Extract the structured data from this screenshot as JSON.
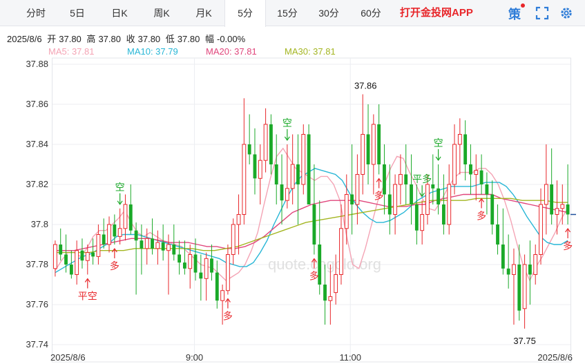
{
  "tabs": [
    "分时",
    "5日",
    "日K",
    "周K",
    "月K",
    "5分",
    "15分",
    "30分",
    "60分"
  ],
  "active_tab": "5分",
  "promo_text": "打开金投网APP",
  "strategy_label": "策",
  "toolbar_icons": [
    "fullscreen-icon",
    "settings-gear-icon"
  ],
  "info_bar": {
    "date": "2025/8/6",
    "open_label": "开",
    "open": "37.80",
    "high_label": "高",
    "high": "37.80",
    "close_label": "收",
    "close": "37.80",
    "low_label": "低",
    "low": "37.80",
    "change_label": "幅",
    "change": "-0.00%"
  },
  "ma_legend": [
    {
      "text": "MA5: 37.81",
      "color": "#f4a3b4"
    },
    {
      "text": "MA10: 37.79",
      "color": "#27b6d6"
    },
    {
      "text": "MA20: 37.81",
      "color": "#e0457b"
    },
    {
      "text": "MA30: 37.81",
      "color": "#a3b520"
    }
  ],
  "watermark": "quote.cngold.org",
  "colors": {
    "up": "#e8262a",
    "down": "#1aa928",
    "grid": "#eceef2"
  },
  "chart_data": {
    "type": "candlestick",
    "y_ticks": [
      "37.88",
      "37.86",
      "37.84",
      "37.82",
      "37.8",
      "37.78",
      "37.76",
      "37.74"
    ],
    "ylim": [
      37.74,
      37.88
    ],
    "x_tick_labels": [
      "2025/8/6",
      "9:00",
      "11:00",
      "2025/8/6"
    ],
    "high_label": "37.86",
    "low_label": "37.75",
    "series": [
      {
        "name": "MA5",
        "values": [
          37.777,
          37.782,
          37.786,
          37.786,
          37.784,
          37.788,
          37.794,
          37.797,
          37.797,
          37.8,
          37.803,
          37.807,
          37.801,
          37.796,
          37.794,
          37.796,
          37.794,
          37.792,
          37.791,
          37.79,
          37.789,
          37.786,
          37.783,
          37.78,
          37.779,
          37.778,
          37.775,
          37.772,
          37.774,
          37.776,
          37.78,
          37.787,
          37.796,
          37.81,
          37.823,
          37.834,
          37.838,
          37.833,
          37.828,
          37.826,
          37.824,
          37.822,
          37.824,
          37.824,
          37.82,
          37.812,
          37.795,
          37.78,
          37.778,
          37.788,
          37.8,
          37.812,
          37.82,
          37.828,
          37.834,
          37.833,
          37.826,
          37.82,
          37.813,
          37.808,
          37.807,
          37.812,
          37.818,
          37.823,
          37.826,
          37.826,
          37.826,
          37.828,
          37.828,
          37.825,
          37.82,
          37.812,
          37.802,
          37.79,
          37.779,
          37.772,
          37.779,
          37.784,
          37.79,
          37.796,
          37.803,
          37.808
        ]
      },
      {
        "name": "MA10",
        "values": [
          37.776,
          37.778,
          37.78,
          37.782,
          37.784,
          37.785,
          37.787,
          37.789,
          37.791,
          37.794,
          37.795,
          37.795,
          37.795,
          37.794,
          37.793,
          37.792,
          37.791,
          37.79,
          37.789,
          37.788,
          37.787,
          37.786,
          37.785,
          37.784,
          37.783,
          37.781,
          37.78,
          37.779,
          37.779,
          37.781,
          37.786,
          37.792,
          37.8,
          37.807,
          37.814,
          37.82,
          37.824,
          37.826,
          37.828,
          37.827,
          37.826,
          37.825,
          37.822,
          37.816,
          37.81,
          37.806,
          37.803,
          37.801,
          37.801,
          37.802,
          37.804,
          37.806,
          37.809,
          37.812,
          37.814,
          37.816,
          37.817,
          37.818,
          37.819,
          37.819,
          37.819,
          37.819,
          37.82,
          37.821,
          37.821,
          37.821,
          37.819,
          37.815,
          37.81,
          37.804,
          37.799,
          37.794,
          37.791,
          37.79,
          37.79,
          37.792
        ]
      },
      {
        "name": "MA20",
        "values": [
          37.787,
          37.787,
          37.787,
          37.788,
          37.789,
          37.79,
          37.791,
          37.792,
          37.793,
          37.793,
          37.793,
          37.792,
          37.791,
          37.791,
          37.791,
          37.79,
          37.789,
          37.789,
          37.788,
          37.788,
          37.789,
          37.791,
          37.794,
          37.798,
          37.802,
          37.806,
          37.808,
          37.81,
          37.811,
          37.812,
          37.812,
          37.812,
          37.812,
          37.811,
          37.81,
          37.809,
          37.809,
          37.809,
          37.81,
          37.81,
          37.812,
          37.813,
          37.814,
          37.815,
          37.815,
          37.815,
          37.815,
          37.813,
          37.812,
          37.811,
          37.81,
          37.809,
          37.808,
          37.807,
          37.806
        ]
      },
      {
        "name": "MA30",
        "values": [
          37.786,
          37.786,
          37.786,
          37.786,
          37.787,
          37.787,
          37.787,
          37.788,
          37.788,
          37.788,
          37.788,
          37.788,
          37.788,
          37.787,
          37.787,
          37.788,
          37.789,
          37.791,
          37.793,
          37.795,
          37.797,
          37.799,
          37.801,
          37.802,
          37.803,
          37.804,
          37.805,
          37.806,
          37.807,
          37.808,
          37.809,
          37.81,
          37.811,
          37.812,
          37.812,
          37.812,
          37.812,
          37.813,
          37.813,
          37.813,
          37.813,
          37.812,
          37.812,
          37.812,
          37.811,
          37.811
        ]
      }
    ],
    "candles": [
      {
        "o": 37.778,
        "h": 37.792,
        "l": 37.774,
        "c": 37.79
      },
      {
        "o": 37.79,
        "h": 37.798,
        "l": 37.782,
        "c": 37.785
      },
      {
        "o": 37.785,
        "h": 37.795,
        "l": 37.776,
        "c": 37.78
      },
      {
        "o": 37.78,
        "h": 37.787,
        "l": 37.773,
        "c": 37.775
      },
      {
        "o": 37.775,
        "h": 37.792,
        "l": 37.77,
        "c": 37.787
      },
      {
        "o": 37.787,
        "h": 37.793,
        "l": 37.778,
        "c": 37.782
      },
      {
        "o": 37.782,
        "h": 37.79,
        "l": 37.775,
        "c": 37.786
      },
      {
        "o": 37.786,
        "h": 37.793,
        "l": 37.78,
        "c": 37.784
      },
      {
        "o": 37.784,
        "h": 37.8,
        "l": 37.78,
        "c": 37.795
      },
      {
        "o": 37.795,
        "h": 37.803,
        "l": 37.788,
        "c": 37.79
      },
      {
        "o": 37.79,
        "h": 37.804,
        "l": 37.786,
        "c": 37.8
      },
      {
        "o": 37.8,
        "h": 37.805,
        "l": 37.79,
        "c": 37.794
      },
      {
        "o": 37.794,
        "h": 37.808,
        "l": 37.79,
        "c": 37.798
      },
      {
        "o": 37.798,
        "h": 37.815,
        "l": 37.792,
        "c": 37.81
      },
      {
        "o": 37.81,
        "h": 37.82,
        "l": 37.795,
        "c": 37.797
      },
      {
        "o": 37.797,
        "h": 37.801,
        "l": 37.765,
        "c": 37.792
      },
      {
        "o": 37.792,
        "h": 37.8,
        "l": 37.775,
        "c": 37.788
      },
      {
        "o": 37.788,
        "h": 37.798,
        "l": 37.78,
        "c": 37.793
      },
      {
        "o": 37.793,
        "h": 37.803,
        "l": 37.785,
        "c": 37.788
      },
      {
        "o": 37.788,
        "h": 37.797,
        "l": 37.78,
        "c": 37.791
      },
      {
        "o": 37.791,
        "h": 37.8,
        "l": 37.782,
        "c": 37.787
      },
      {
        "o": 37.787,
        "h": 37.795,
        "l": 37.765,
        "c": 37.79
      },
      {
        "o": 37.79,
        "h": 37.8,
        "l": 37.782,
        "c": 37.785
      },
      {
        "o": 37.785,
        "h": 37.792,
        "l": 37.775,
        "c": 37.781
      },
      {
        "o": 37.781,
        "h": 37.792,
        "l": 37.775,
        "c": 37.778
      },
      {
        "o": 37.778,
        "h": 37.79,
        "l": 37.768,
        "c": 37.785
      },
      {
        "o": 37.785,
        "h": 37.793,
        "l": 37.772,
        "c": 37.776
      },
      {
        "o": 37.776,
        "h": 37.785,
        "l": 37.762,
        "c": 37.773
      },
      {
        "o": 37.773,
        "h": 37.786,
        "l": 37.762,
        "c": 37.783
      },
      {
        "o": 37.783,
        "h": 37.79,
        "l": 37.772,
        "c": 37.776
      },
      {
        "o": 37.776,
        "h": 37.782,
        "l": 37.758,
        "c": 37.762
      },
      {
        "o": 37.762,
        "h": 37.77,
        "l": 37.75,
        "c": 37.767
      },
      {
        "o": 37.767,
        "h": 37.79,
        "l": 37.765,
        "c": 37.785
      },
      {
        "o": 37.785,
        "h": 37.803,
        "l": 37.78,
        "c": 37.8
      },
      {
        "o": 37.8,
        "h": 37.815,
        "l": 37.785,
        "c": 37.805
      },
      {
        "o": 37.805,
        "h": 37.863,
        "l": 37.8,
        "c": 37.84
      },
      {
        "o": 37.84,
        "h": 37.855,
        "l": 37.83,
        "c": 37.835
      },
      {
        "o": 37.835,
        "h": 37.848,
        "l": 37.815,
        "c": 37.823
      },
      {
        "o": 37.823,
        "h": 37.84,
        "l": 37.81,
        "c": 37.832
      },
      {
        "o": 37.832,
        "h": 37.858,
        "l": 37.826,
        "c": 37.85
      },
      {
        "o": 37.85,
        "h": 37.855,
        "l": 37.825,
        "c": 37.83
      },
      {
        "o": 37.83,
        "h": 37.845,
        "l": 37.81,
        "c": 37.82
      },
      {
        "o": 37.82,
        "h": 37.835,
        "l": 37.8,
        "c": 37.812
      },
      {
        "o": 37.812,
        "h": 37.84,
        "l": 37.808,
        "c": 37.818
      },
      {
        "o": 37.818,
        "h": 37.845,
        "l": 37.81,
        "c": 37.83
      },
      {
        "o": 37.83,
        "h": 37.845,
        "l": 37.8,
        "c": 37.82
      },
      {
        "o": 37.82,
        "h": 37.85,
        "l": 37.815,
        "c": 37.845
      },
      {
        "o": 37.845,
        "h": 37.85,
        "l": 37.81,
        "c": 37.81
      },
      {
        "o": 37.81,
        "h": 37.83,
        "l": 37.785,
        "c": 37.79
      },
      {
        "o": 37.79,
        "h": 37.812,
        "l": 37.765,
        "c": 37.77
      },
      {
        "o": 37.77,
        "h": 37.78,
        "l": 37.75,
        "c": 37.762
      },
      {
        "o": 37.762,
        "h": 37.78,
        "l": 37.75,
        "c": 37.764
      },
      {
        "o": 37.766,
        "h": 37.785,
        "l": 37.76,
        "c": 37.775
      },
      {
        "o": 37.775,
        "h": 37.81,
        "l": 37.77,
        "c": 37.798
      },
      {
        "o": 37.798,
        "h": 37.825,
        "l": 37.79,
        "c": 37.815
      },
      {
        "o": 37.815,
        "h": 37.84,
        "l": 37.795,
        "c": 37.81
      },
      {
        "o": 37.81,
        "h": 37.835,
        "l": 37.8,
        "c": 37.825
      },
      {
        "o": 37.825,
        "h": 37.865,
        "l": 37.815,
        "c": 37.845
      },
      {
        "o": 37.845,
        "h": 37.86,
        "l": 37.82,
        "c": 37.83
      },
      {
        "o": 37.83,
        "h": 37.855,
        "l": 37.815,
        "c": 37.85
      },
      {
        "o": 37.85,
        "h": 37.86,
        "l": 37.825,
        "c": 37.83
      },
      {
        "o": 37.83,
        "h": 37.84,
        "l": 37.805,
        "c": 37.815
      },
      {
        "o": 37.815,
        "h": 37.83,
        "l": 37.795,
        "c": 37.805
      },
      {
        "o": 37.805,
        "h": 37.825,
        "l": 37.795,
        "c": 37.82
      },
      {
        "o": 37.82,
        "h": 37.835,
        "l": 37.81,
        "c": 37.825
      },
      {
        "o": 37.825,
        "h": 37.84,
        "l": 37.81,
        "c": 37.82
      },
      {
        "o": 37.82,
        "h": 37.835,
        "l": 37.8,
        "c": 37.81
      },
      {
        "o": 37.81,
        "h": 37.82,
        "l": 37.79,
        "c": 37.797
      },
      {
        "o": 37.797,
        "h": 37.812,
        "l": 37.79,
        "c": 37.805
      },
      {
        "o": 37.805,
        "h": 37.825,
        "l": 37.8,
        "c": 37.82
      },
      {
        "o": 37.82,
        "h": 37.835,
        "l": 37.81,
        "c": 37.818
      },
      {
        "o": 37.818,
        "h": 37.83,
        "l": 37.805,
        "c": 37.81
      },
      {
        "o": 37.81,
        "h": 37.825,
        "l": 37.795,
        "c": 37.8
      },
      {
        "o": 37.8,
        "h": 37.83,
        "l": 37.795,
        "c": 37.82
      },
      {
        "o": 37.82,
        "h": 37.85,
        "l": 37.815,
        "c": 37.84
      },
      {
        "o": 37.84,
        "h": 37.853,
        "l": 37.825,
        "c": 37.845
      },
      {
        "o": 37.845,
        "h": 37.852,
        "l": 37.822,
        "c": 37.83
      },
      {
        "o": 37.83,
        "h": 37.84,
        "l": 37.815,
        "c": 37.825
      },
      {
        "o": 37.825,
        "h": 37.835,
        "l": 37.812,
        "c": 37.827
      },
      {
        "o": 37.827,
        "h": 37.835,
        "l": 37.815,
        "c": 37.82
      },
      {
        "o": 37.82,
        "h": 37.826,
        "l": 37.805,
        "c": 37.815
      },
      {
        "o": 37.815,
        "h": 37.822,
        "l": 37.795,
        "c": 37.8
      },
      {
        "o": 37.8,
        "h": 37.81,
        "l": 37.785,
        "c": 37.79
      },
      {
        "o": 37.79,
        "h": 37.808,
        "l": 37.775,
        "c": 37.778
      },
      {
        "o": 37.778,
        "h": 37.795,
        "l": 37.768,
        "c": 37.775
      },
      {
        "o": 37.775,
        "h": 37.788,
        "l": 37.75,
        "c": 37.78
      },
      {
        "o": 37.78,
        "h": 37.79,
        "l": 37.752,
        "c": 37.757
      },
      {
        "o": 37.758,
        "h": 37.785,
        "l": 37.748,
        "c": 37.78
      },
      {
        "o": 37.78,
        "h": 37.792,
        "l": 37.76,
        "c": 37.775
      },
      {
        "o": 37.775,
        "h": 37.79,
        "l": 37.77,
        "c": 37.785
      },
      {
        "o": 37.785,
        "h": 37.818,
        "l": 37.78,
        "c": 37.81
      },
      {
        "o": 37.81,
        "h": 37.84,
        "l": 37.795,
        "c": 37.82
      },
      {
        "o": 37.82,
        "h": 37.838,
        "l": 37.8,
        "c": 37.805
      },
      {
        "o": 37.805,
        "h": 37.822,
        "l": 37.795,
        "c": 37.808
      },
      {
        "o": 37.808,
        "h": 37.82,
        "l": 37.8,
        "c": 37.81
      },
      {
        "o": 37.81,
        "h": 37.83,
        "l": 37.8,
        "c": 37.805
      }
    ],
    "signals": [
      {
        "label": "平空",
        "type": "buy",
        "index": 11
      },
      {
        "label": "多",
        "type": "buy",
        "index": 19
      },
      {
        "label": "空",
        "type": "sell",
        "index": 21
      },
      {
        "label": "多",
        "type": "buy",
        "index": 56
      },
      {
        "label": "空",
        "type": "sell",
        "index": 75
      },
      {
        "label": "多",
        "type": "buy",
        "index": 83
      },
      {
        "label": "平多",
        "type": "sell",
        "index": 118
      },
      {
        "label": "多",
        "type": "buy",
        "index": 104
      },
      {
        "label": "多",
        "type": "buy",
        "index": 137
      },
      {
        "label": "空",
        "type": "sell",
        "index": 123
      },
      {
        "label": "多",
        "type": "buy",
        "index": 165
      }
    ]
  }
}
